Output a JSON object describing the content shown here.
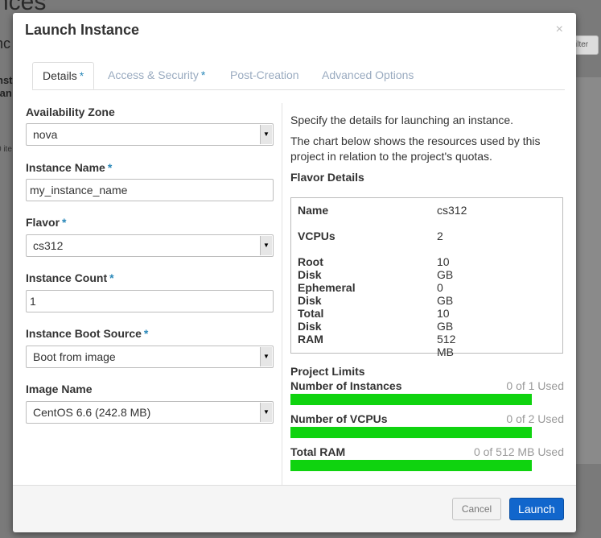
{
  "background": {
    "title_fragment": "nces",
    "side_fragment_1": "nc",
    "side_fragment_2a": "nst",
    "side_fragment_2b": "lan",
    "side_fragment_3": "0 ite",
    "filter_fragment": "ilter"
  },
  "modal": {
    "title": "Launch Instance",
    "close_glyph": "×"
  },
  "tabs": [
    {
      "label": "Details",
      "required": "*",
      "active": true
    },
    {
      "label": "Access & Security",
      "required": "*",
      "active": false
    },
    {
      "label": "Post-Creation",
      "required": "",
      "active": false
    },
    {
      "label": "Advanced Options",
      "required": "",
      "active": false
    }
  ],
  "form": {
    "availability_zone": {
      "label": "Availability Zone",
      "value": "nova"
    },
    "instance_name": {
      "label": "Instance Name",
      "required": "*",
      "value": "my_instance_name"
    },
    "flavor": {
      "label": "Flavor",
      "required": "*",
      "value": "cs312"
    },
    "instance_count": {
      "label": "Instance Count",
      "required": "*",
      "value": "1"
    },
    "boot_source": {
      "label": "Instance Boot Source",
      "required": "*",
      "value": "Boot from image"
    },
    "image_name": {
      "label": "Image Name",
      "value": "CentOS 6.6 (242.8 MB)"
    }
  },
  "info": {
    "desc1": "Specify the details for launching an instance.",
    "desc2": "The chart below shows the resources used by this project in relation to the project's quotas.",
    "flavor_details_title": "Flavor Details",
    "flavor_details": [
      {
        "key": "Name",
        "value": "cs312"
      },
      {
        "key": "VCPUs",
        "value": "2"
      },
      {
        "key": "Root Disk",
        "value": "10 GB"
      },
      {
        "key": "Ephemeral Disk",
        "value": "0 GB"
      },
      {
        "key": "Total Disk",
        "value": "10 GB"
      },
      {
        "key": "RAM",
        "value": "512 MB"
      }
    ],
    "project_limits_title": "Project Limits",
    "limits": [
      {
        "label": "Number of Instances",
        "used": "0 of 1 Used",
        "fraction": 1.0
      },
      {
        "label": "Number of VCPUs",
        "used": "0 of 2 Used",
        "fraction": 1.0
      },
      {
        "label": "Total RAM",
        "used": "0 of 512 MB Used",
        "fraction": 1.0
      }
    ],
    "bar_color": "#0fd30f"
  },
  "footer": {
    "cancel_label": "Cancel",
    "launch_label": "Launch"
  }
}
